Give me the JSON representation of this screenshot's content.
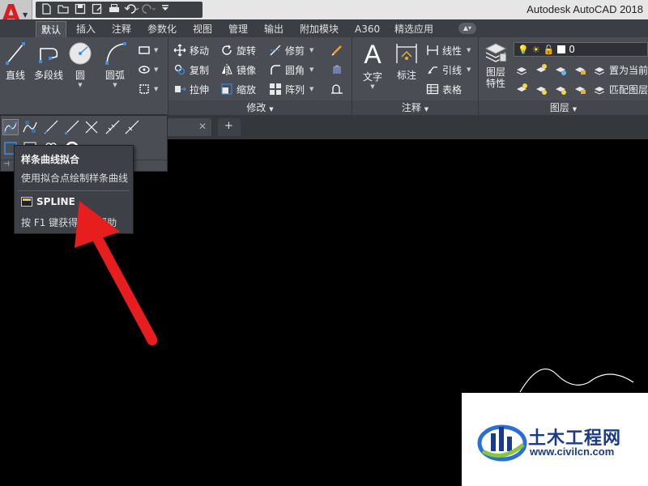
{
  "app": {
    "title": "Autodesk AutoCAD 2018",
    "logo_letter": "A"
  },
  "quick_access": [
    {
      "icon": "new-file-icon"
    },
    {
      "icon": "open-folder-icon"
    },
    {
      "icon": "save-icon"
    },
    {
      "icon": "save-as-icon"
    },
    {
      "icon": "print-icon"
    },
    {
      "icon": "undo-icon"
    },
    {
      "icon": "redo-icon"
    },
    {
      "icon": "customize-dropdown-icon"
    }
  ],
  "ribbon_tabs": [
    "默认",
    "插入",
    "注释",
    "参数化",
    "视图",
    "管理",
    "输出",
    "附加模块",
    "A360",
    "精选应用"
  ],
  "draw_panel": {
    "line": "直线",
    "polyline": "多段线",
    "circle": "圆",
    "arc": "圆弧"
  },
  "modify_panel": {
    "title": "修改",
    "move": "移动",
    "rotate": "旋转",
    "trim": "修剪",
    "copy": "复制",
    "mirror": "镜像",
    "fillet": "圆角",
    "stretch": "拉伸",
    "scale": "缩放",
    "array": "阵列"
  },
  "annotation_panel": {
    "title": "注释",
    "text": "文字",
    "dimension": "标注",
    "linear": "线性",
    "leader": "引线",
    "table": "表格"
  },
  "layers_panel": {
    "title": "图层",
    "properties": "图层\n特性",
    "properties_line1": "图层",
    "properties_line2": "特性",
    "current_layer": "0",
    "set_current": "置为当前",
    "match_layer": "匹配图层"
  },
  "tooltip": {
    "title": "样条曲线拟合",
    "description": "使用拟合点绘制样条曲线",
    "command": "SPLINE",
    "help": "按 F1 键获得更多帮助"
  },
  "watermark": {
    "name": "土木工程网",
    "url": "www.civilcn.com"
  },
  "colors": {
    "accent_red": "#e81e1e",
    "ribbon_bg": "#4a4d54",
    "canvas_bg": "#000000"
  }
}
